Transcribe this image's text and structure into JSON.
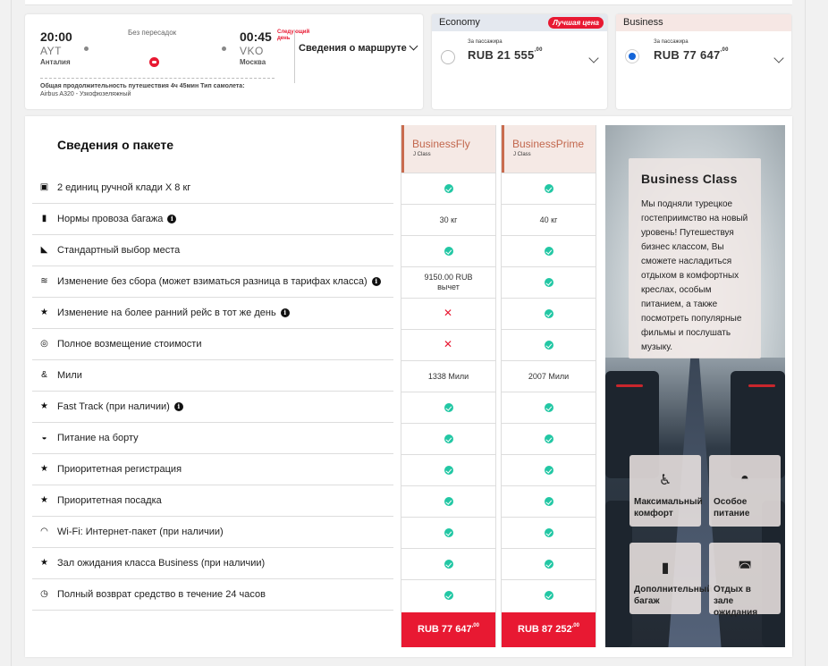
{
  "flight": {
    "dep_time": "20:00",
    "dep_code": "AYT",
    "dep_city": "Анталия",
    "arr_time": "00:45",
    "arr_code": "VKO",
    "arr_city": "Москва",
    "stops": "Без пересадок",
    "next_day": "Следующий день",
    "details_label": "Сведения о маршруте",
    "duration_label": "Общая продолжительность путешествия",
    "duration_value": "4ч 45мин",
    "aircraft_label": "Тип самолета:",
    "aircraft_value": "Airbus A320 - Узкофюзеляжный"
  },
  "fares": {
    "economy": {
      "name": "Economy",
      "badge": "Лучшая цена",
      "per_pax": "За пассажира",
      "price": "RUB 21 555",
      "cents": ",00",
      "selected": false
    },
    "business": {
      "name": "Business",
      "per_pax": "За пассажира",
      "price": "RUB 77 647",
      "cents": ",00",
      "selected": true
    }
  },
  "package": {
    "title": "Сведения о пакете",
    "rows": [
      {
        "icon": "cabin-bag-icon",
        "glyph": "▣",
        "label": "2 единиц ручной клади X 8 кг",
        "info": false
      },
      {
        "icon": "baggage-icon",
        "glyph": "▮",
        "label": "Нормы провоза багажа",
        "info": true
      },
      {
        "icon": "seat-icon",
        "glyph": "◣",
        "label": "Стандартный выбор места",
        "info": false
      },
      {
        "icon": "change-icon",
        "glyph": "≋",
        "label": "Изменение без сбора (может взиматься разница в тарифах класса)",
        "info": true
      },
      {
        "icon": "star-icon",
        "glyph": "★",
        "label": "Изменение на более ранний рейс в тот же день",
        "info": true
      },
      {
        "icon": "refund-icon",
        "glyph": "◎",
        "label": "Полное возмещение стоимости",
        "info": false
      },
      {
        "icon": "miles-icon",
        "glyph": "&",
        "label": "Мили",
        "info": false
      },
      {
        "icon": "star-icon",
        "glyph": "★",
        "label": "Fast Track (при наличии)",
        "info": true
      },
      {
        "icon": "meal-icon",
        "glyph": "◒",
        "label": "Питание на борту",
        "info": false
      },
      {
        "icon": "star-icon",
        "glyph": "★",
        "label": "Приоритетная регистрация",
        "info": false
      },
      {
        "icon": "star-icon",
        "glyph": "★",
        "label": "Приоритетная посадка",
        "info": false
      },
      {
        "icon": "wifi-icon",
        "glyph": "◠",
        "label": "Wi-Fi: Интернет-пакет (при наличии)",
        "info": false
      },
      {
        "icon": "star-icon",
        "glyph": "★",
        "label": "Зал ожидания класса Business (при наличии)",
        "info": false
      },
      {
        "icon": "clock-refund-icon",
        "glyph": "◷",
        "label": "Полный возврат средство в течение 24 часов",
        "info": false
      }
    ]
  },
  "brands": [
    {
      "name": "BusinessFly",
      "class": "J Class",
      "cells": [
        "check",
        "30 кг",
        "check",
        "9150.00 RUB|вычет",
        "cross",
        "cross",
        "1338 Мили",
        "check",
        "check",
        "check",
        "check",
        "check",
        "check",
        "check"
      ],
      "price": "RUB 77 647",
      "cents": ",00"
    },
    {
      "name": "BusinessPrime",
      "class": "J Class",
      "cells": [
        "check",
        "40 кг",
        "check",
        "check",
        "check",
        "check",
        "2007 Мили",
        "check",
        "check",
        "check",
        "check",
        "check",
        "check",
        "check"
      ],
      "price": "RUB 87 252",
      "cents": ",00"
    }
  ],
  "promo": {
    "title": "Business Class",
    "text": "Мы подняли турецкое гостеприимство на новый уровень! Путешествуя бизнес классом, Вы сможете насладиться отдыхом в комфортных креслах, особым питанием, а также посмотреть популярные фильмы и послушать музыку.",
    "features": [
      {
        "icon": "comfort-seat-icon",
        "glyph": "♿",
        "label": "Максимальный\nкомфорт"
      },
      {
        "icon": "special-meal-icon",
        "glyph": "◓",
        "label": "Особое\nпитание"
      },
      {
        "icon": "extra-baggage-icon",
        "glyph": "▮",
        "label": "Дополнительный\nбагаж"
      },
      {
        "icon": "lounge-icon",
        "glyph": "◚",
        "label": "Отдых в\nзале\nожидания"
      }
    ]
  },
  "colors": {
    "accent_red": "#e81932",
    "check_green": "#22c7a4",
    "brand_text": "#c2674d",
    "select_blue": "#1565d8"
  }
}
